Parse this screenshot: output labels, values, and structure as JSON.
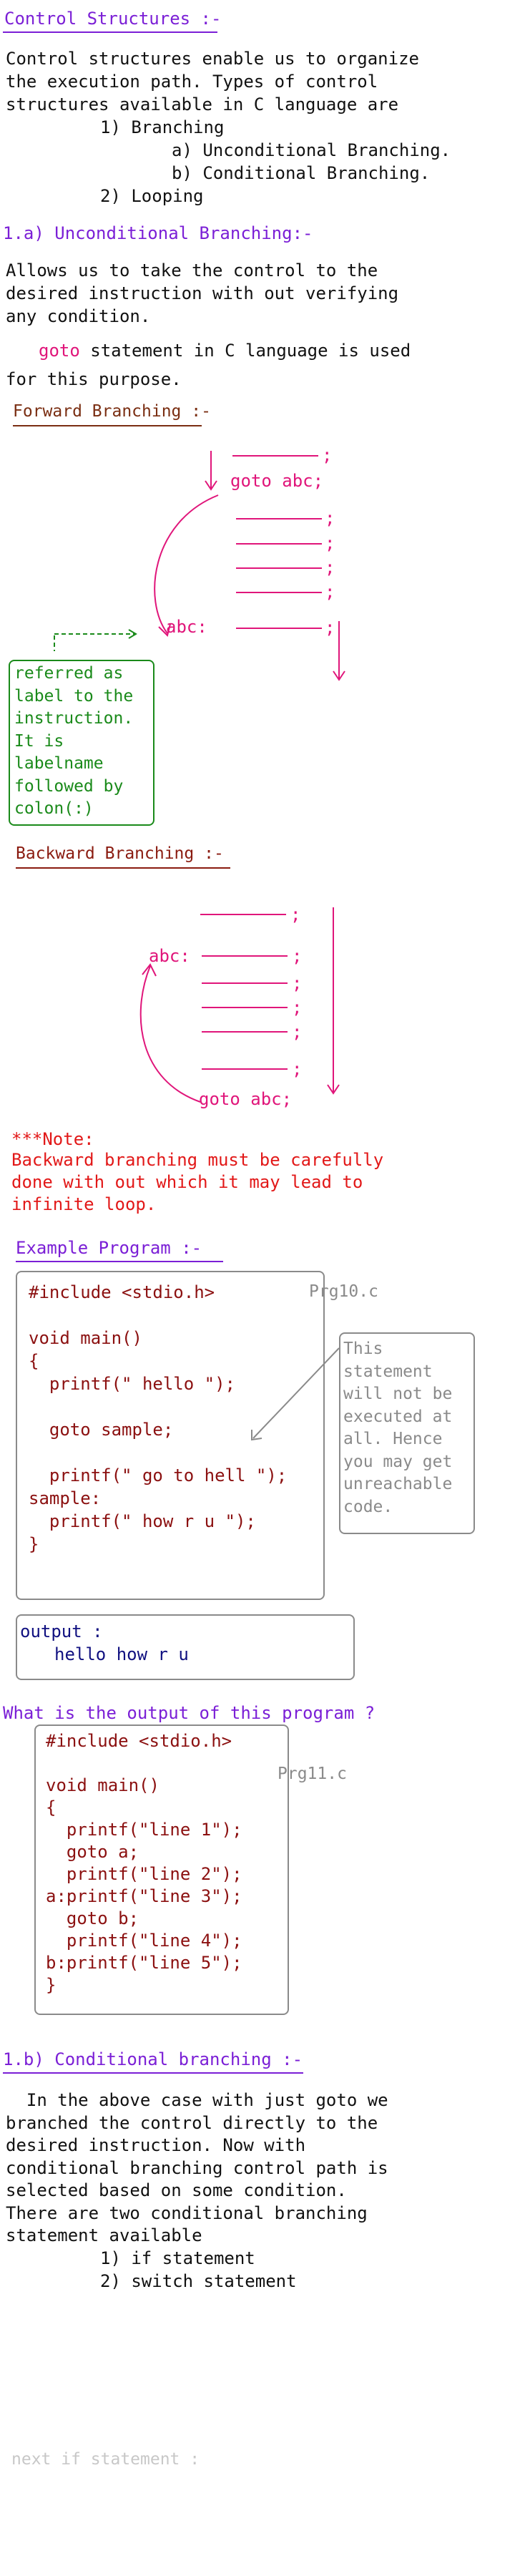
{
  "heading": "Control Structures :-",
  "intro": [
    "Control structures enable us to organize",
    "the execution path. Types of control",
    "structures available in C language are"
  ],
  "types": {
    "t1": "1) Branching",
    "t1a": "a) Unconditional Branching.",
    "t1b": "b) Conditional Branching.",
    "t2": "2) Looping"
  },
  "uncond": {
    "heading": "1.a) Unconditional Branching:-",
    "desc": [
      "Allows us to take the control to the",
      "desired instruction with out verifying",
      "any condition."
    ],
    "goto_kw": "goto",
    "goto_rest": "statement in C language is used",
    "goto_line2": "for this purpose."
  },
  "forward": {
    "heading": "Forward Branching :-",
    "semi": ";",
    "goto_stmt": "goto abc;",
    "label": "abc:",
    "note": [
      "referred as",
      "label to the",
      "instruction.",
      "It is",
      "labelname",
      "followed by",
      "colon(:)"
    ]
  },
  "backward": {
    "heading": "Backward Branching :-",
    "semi": ";",
    "label": "abc:",
    "goto_stmt": "goto abc;"
  },
  "note": {
    "title": "***Note:",
    "lines": [
      "Backward branching must be carefully",
      "done with out which it may lead to",
      "infinite loop."
    ]
  },
  "example": {
    "heading": "Example Program :-",
    "filename": "Prg10.c",
    "code": [
      "#include <stdio.h>",
      "",
      "void main()",
      "{",
      "  printf(\" hello \");",
      "",
      "  goto sample;",
      "",
      "  printf(\" go to hell \");",
      "sample:",
      "  printf(\" how r u \");",
      "}"
    ],
    "callout": [
      "This",
      "statement",
      "will not be",
      "executed at",
      "all. Hence",
      "you may get",
      "unreachable",
      "code."
    ],
    "output_label": "output :",
    "output_value": "hello how r u"
  },
  "question": {
    "heading": "What is the output of this program ?",
    "filename": "Prg11.c",
    "code": [
      "#include <stdio.h>",
      "",
      "void main()",
      "{",
      "  printf(\"line 1\");",
      "  goto a;",
      "  printf(\"line 2\");",
      "a:printf(\"line 3\");",
      "  goto b;",
      "  printf(\"line 4\");",
      "b:printf(\"line 5\");",
      "}"
    ]
  },
  "cond": {
    "heading": "1.b) Conditional branching :-",
    "desc": [
      "In the above case with just goto we",
      "branched the control directly to the",
      "desired instruction. Now with",
      "conditional branching control path is",
      "selected based on some condition.",
      "There are two conditional branching",
      "statement available"
    ],
    "items": [
      "1) if statement",
      "2) switch statement"
    ]
  },
  "next": "next if statement :",
  "colors": {
    "purple": "#7b1fd6",
    "pink": "#e0157a",
    "green": "#1a8a1a",
    "red": "#e21818",
    "code": "#8b1010",
    "navy": "#101080"
  }
}
